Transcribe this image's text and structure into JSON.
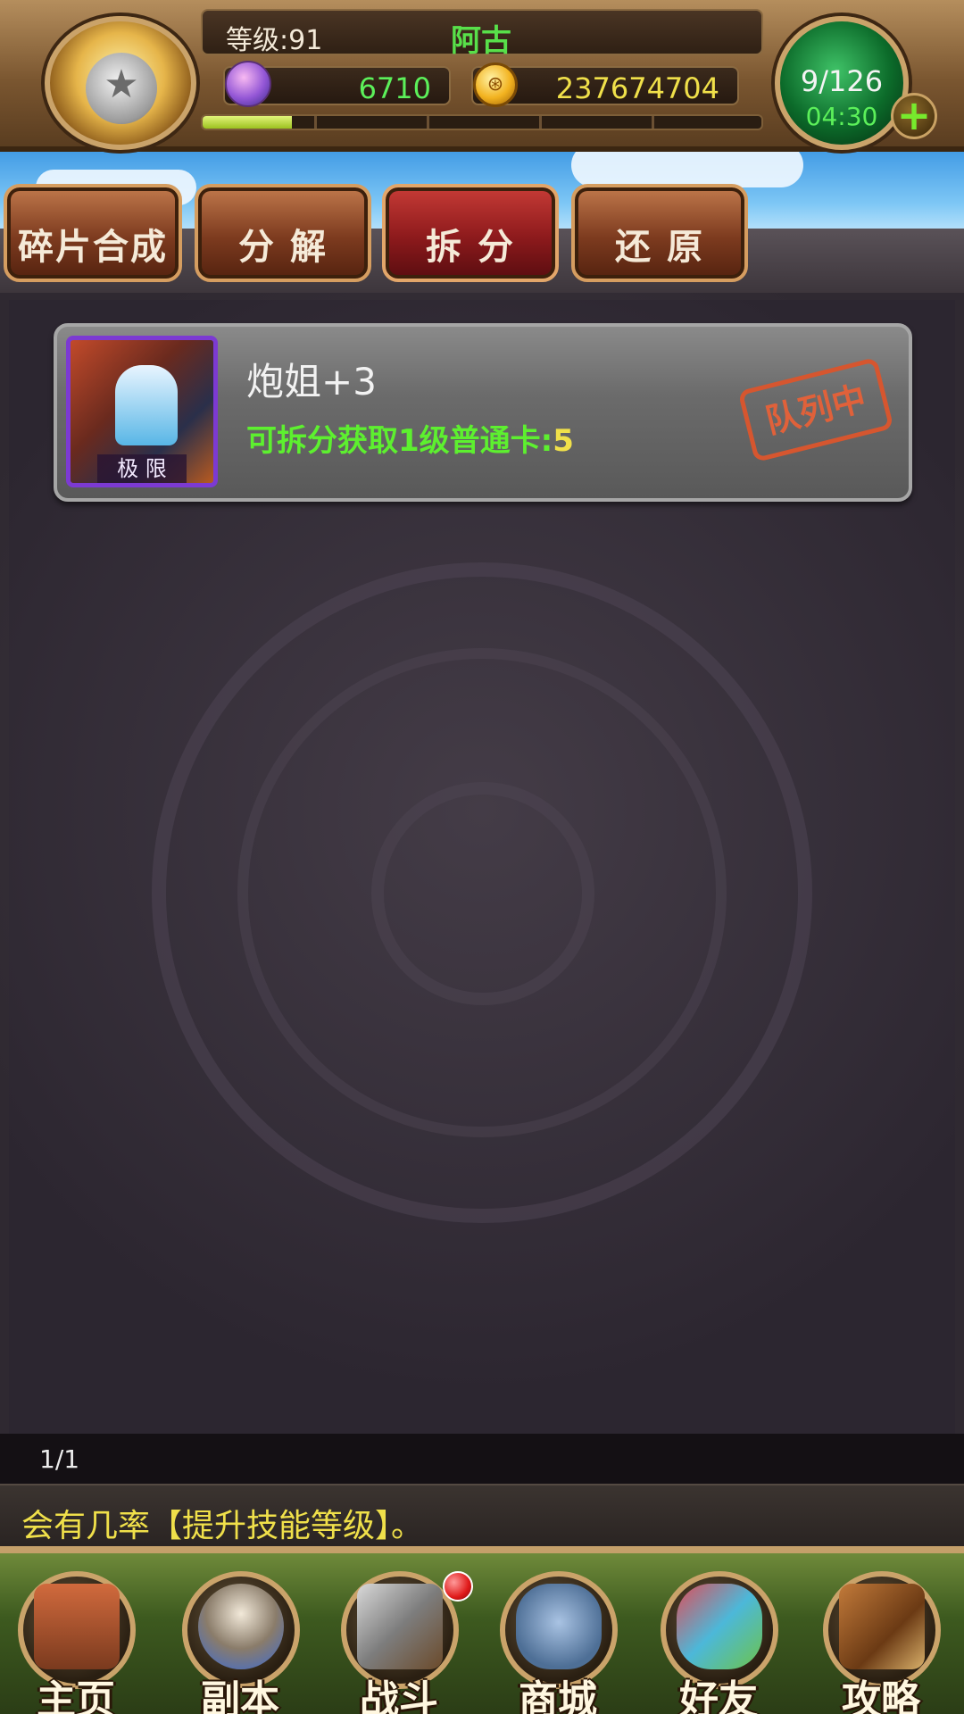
{
  "header": {
    "level_text": "等级:91",
    "player_name": "阿古",
    "gems": "6710",
    "gold": "237674704",
    "gold_icon_glyph": "⊛",
    "energy": "9/126",
    "energy_timer": "04:30",
    "plus_label": "+",
    "exp_fraction": 0.16
  },
  "tabs": [
    {
      "label": "碎片合成"
    },
    {
      "label": "分 解"
    },
    {
      "label": "拆 分"
    },
    {
      "label": "还 原"
    }
  ],
  "card": {
    "name": "炮姐+3",
    "info_prefix": "可拆分获取1级普通卡:",
    "info_value": "5",
    "portrait_badge": "极 限",
    "status_stamp": "队列中"
  },
  "pager": {
    "text": "1/1"
  },
  "tip": {
    "text": "会有几率【提升技能等级】。"
  },
  "bottom_nav": [
    {
      "label": "主页"
    },
    {
      "label": "副本"
    },
    {
      "label": "战斗"
    },
    {
      "label": "商城"
    },
    {
      "label": "好友"
    },
    {
      "label": "攻略"
    }
  ],
  "colors": {
    "name_green": "#58e04a",
    "info_green": "#5df02f",
    "yellow": "#f0e04a",
    "stamp_orange": "#d6562f",
    "active_tab_red": "#8d1a1c"
  }
}
